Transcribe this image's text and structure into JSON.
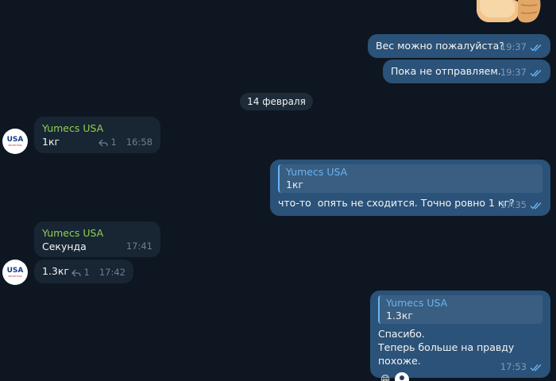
{
  "date_separator": "14 февраля",
  "contact": {
    "name": "Yumecs USA",
    "avatar_text": "USA",
    "avatar_sub": "RECEPTION"
  },
  "messages": {
    "m1": {
      "text": "Вес можно пожалуйста?",
      "time": "19:37"
    },
    "m2": {
      "text": "Пока не отправляем.",
      "time": "19:37"
    },
    "m3": {
      "sender": "Yumecs USA",
      "text": "1кг",
      "replies": "1",
      "time": "16:58"
    },
    "m4": {
      "quote_name": "Yumecs USA",
      "quote_text": "1кг",
      "text": "что-то  опять не сходится. Точно ровно 1 кг?",
      "time": "17:35"
    },
    "m5": {
      "sender": "Yumecs USA",
      "text": "Секунда",
      "time": "17:41"
    },
    "m6": {
      "text": "1.3кг",
      "replies": "1",
      "time": "17:42"
    },
    "m7": {
      "quote_name": "Yumecs USA",
      "quote_text": "1.3кг",
      "line1": "Спасибо.",
      "line2": "Теперь больше на правду похоже.",
      "reaction_emoji": "😁",
      "time": "17:53"
    }
  },
  "colors": {
    "background": "#0e1621",
    "outgoing": "#2b5278",
    "incoming": "#182533",
    "sender_name": "#8fd14f",
    "quote_accent": "#6ab3f3"
  }
}
